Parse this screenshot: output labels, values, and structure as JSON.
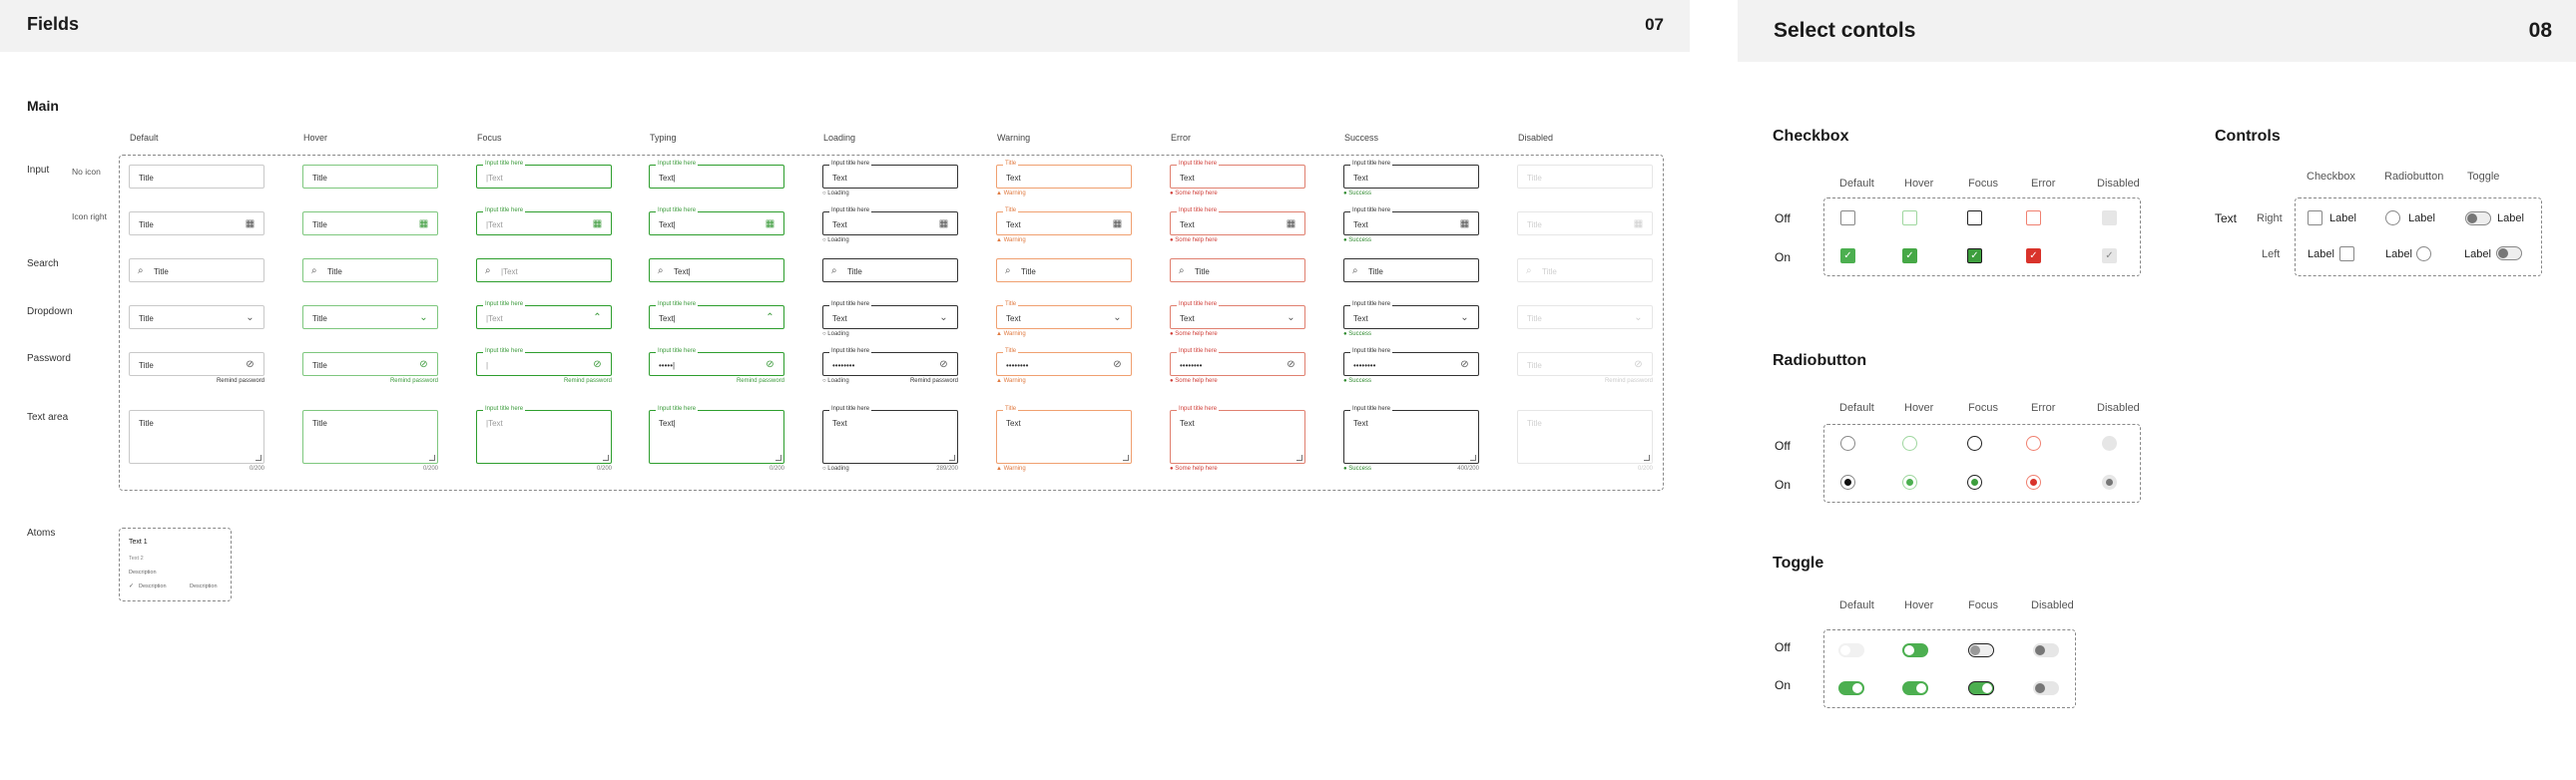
{
  "fields_page": {
    "title": "Fields",
    "number": "07",
    "section_main": "Main",
    "section_atoms": "Atoms",
    "columns": [
      "Default",
      "Hover",
      "Focus",
      "Typing",
      "Loading",
      "Warning",
      "Error",
      "Success",
      "Disabled"
    ],
    "rows": {
      "input": "Input",
      "no_icon": "No icon",
      "icon_right": "Icon right",
      "search": "Search",
      "dropdown": "Dropdown",
      "password": "Password",
      "textarea": "Text area"
    },
    "values": {
      "title": "Title",
      "text": "Text",
      "text_cursor": "Text|",
      "cursor_text": "|Text",
      "float_label": "Input title here",
      "title_small": "Title",
      "password_mask": "••••••••",
      "password_typing": "•••••|",
      "remind": "Remind password",
      "helper_loading": "Loading",
      "helper_warning": "Warning",
      "helper_error": "Some help here",
      "helper_success": "Success",
      "count_0": "0/200",
      "count_loading": "289/200",
      "count_success": "400/200"
    },
    "atoms": {
      "text1": "Text 1",
      "text2": "Text 2",
      "description": "Description",
      "desc_a": "Description",
      "desc_b": "Description"
    }
  },
  "select_page": {
    "title": "Select contols",
    "number": "08",
    "checkbox": {
      "title": "Checkbox",
      "columns": [
        "Default",
        "Hover",
        "Focus",
        "Error",
        "Disabled"
      ],
      "rows": [
        "Off",
        "On"
      ]
    },
    "radiobutton": {
      "title": "Radiobutton",
      "columns": [
        "Default",
        "Hover",
        "Focus",
        "Error",
        "Disabled"
      ],
      "rows": [
        "Off",
        "On"
      ]
    },
    "toggle": {
      "title": "Toggle",
      "columns": [
        "Default",
        "Hover",
        "Focus",
        "Disabled"
      ],
      "rows": [
        "Off",
        "On"
      ]
    },
    "controls": {
      "title": "Controls",
      "columns": [
        "Checkbox",
        "Radiobutton",
        "Toggle"
      ],
      "text_label": "Text",
      "right": "Right",
      "left": "Left",
      "label": "Label"
    }
  },
  "colors": {
    "green": "#4caf50",
    "orange": "#e07a40",
    "red": "#d9332b",
    "header_bg": "#f2f2f2"
  },
  "icons": [
    "calendar-icon",
    "search-icon",
    "chevron-down-icon",
    "chevron-up-icon",
    "eye-off-icon",
    "spinner-icon",
    "warning-icon",
    "error-icon",
    "success-icon",
    "check-icon"
  ]
}
